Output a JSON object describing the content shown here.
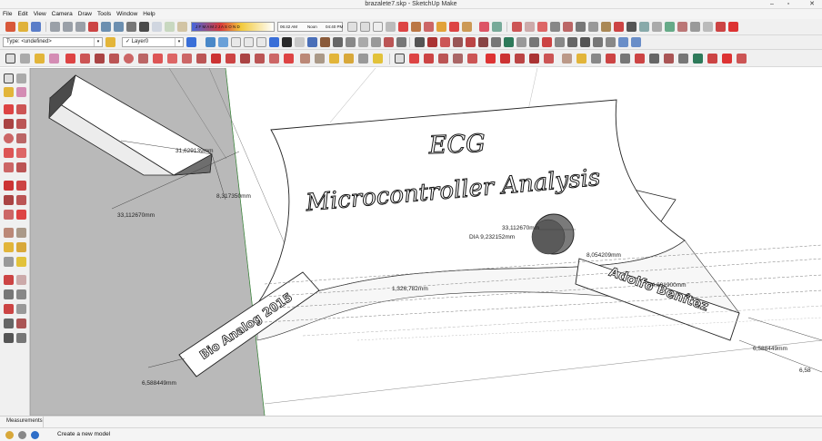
{
  "window": {
    "title": "brazalete7.skp - SketchUp Make",
    "minimize_glyph": "–",
    "maximize_glyph": "▫",
    "close_glyph": "✕"
  },
  "menu": {
    "items": [
      "File",
      "Edit",
      "View",
      "Camera",
      "Draw",
      "Tools",
      "Window",
      "Help"
    ]
  },
  "toolbar": {
    "shadow_months": "J F M A M J J A S O N D",
    "time_start": "06:42 AM",
    "time_noon": "Noon",
    "time_end": "04:40 PM",
    "type_combo": "Type: <undefined>",
    "layer_combo": "Layer0",
    "layer_check": "✓",
    "combo_arrow": "▾"
  },
  "model": {
    "title_line1": "ECG",
    "title_line2": "Microcontroller Analysis",
    "left_band_text": "Bio Analog 2015",
    "right_band_text": "Adolfo Benítez"
  },
  "dimensions": {
    "d1": "31,629139mm",
    "d2": "8,317350mm",
    "d3": "33,112670mm",
    "d4": "33,112670mm",
    "d5": "DIA 9,232152mm",
    "d6": "8,054209mm",
    "d7": "1,326,782mm",
    "d8": "34,601900mm",
    "d9": "6,588449mm",
    "d10": "6,588449mm",
    "d11": "6,58"
  },
  "measurements": {
    "label": "Measurements"
  },
  "status": {
    "message": "Create a new model"
  },
  "colors": {
    "accent_red": "#d83a3a",
    "accent_blue": "#3a6fd8",
    "accent_yellow": "#e8b82a",
    "toolbar_bg": "#f0f0f0",
    "wall_gray": "#b9b9b9"
  }
}
